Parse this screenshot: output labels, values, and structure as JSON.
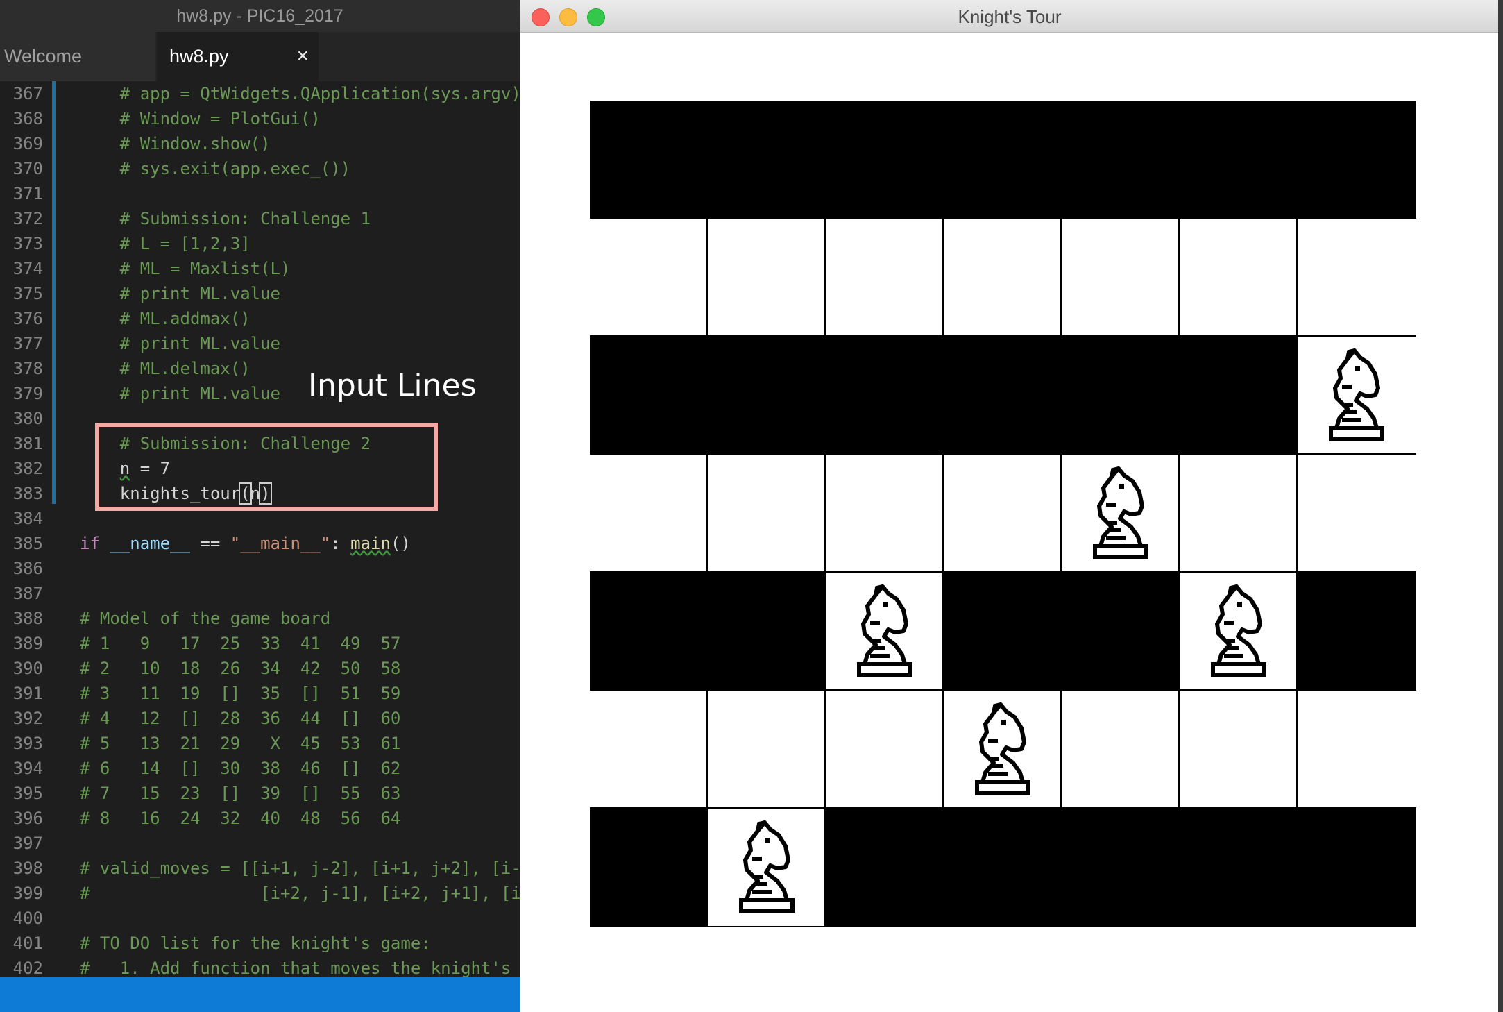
{
  "editor": {
    "window_title": "hw8.py - PIC16_2017",
    "tabs": [
      {
        "label": "Welcome"
      },
      {
        "label": "hw8.py",
        "close": "×"
      }
    ]
  },
  "code_lines": [
    {
      "n": "367",
      "t": "    # app = QtWidgets.QApplication(sys.argv)"
    },
    {
      "n": "368",
      "t": "    # Window = PlotGui()"
    },
    {
      "n": "369",
      "t": "    # Window.show()"
    },
    {
      "n": "370",
      "t": "    # sys.exit(app.exec_())"
    },
    {
      "n": "371",
      "t": ""
    },
    {
      "n": "372",
      "t": "    # Submission: Challenge 1"
    },
    {
      "n": "373",
      "t": "    # L = [1,2,3]"
    },
    {
      "n": "374",
      "t": "    # ML = Maxlist(L)"
    },
    {
      "n": "375",
      "t": "    # print ML.value"
    },
    {
      "n": "376",
      "t": "    # ML.addmax()"
    },
    {
      "n": "377",
      "t": "    # print ML.value"
    },
    {
      "n": "378",
      "t": "    # ML.delmax()"
    },
    {
      "n": "379",
      "t": "    # print ML.value"
    },
    {
      "n": "380",
      "t": ""
    },
    {
      "n": "381",
      "t": "    # Submission: Challenge 2"
    },
    {
      "n": "382",
      "t": "    n = 7"
    },
    {
      "n": "383",
      "t": "    knights_tour(n)"
    },
    {
      "n": "384",
      "t": ""
    },
    {
      "n": "385",
      "t": "if __name__ == \"__main__\": main()"
    },
    {
      "n": "386",
      "t": ""
    },
    {
      "n": "387",
      "t": ""
    },
    {
      "n": "388",
      "t": "# Model of the game board"
    },
    {
      "n": "389",
      "t": "# 1   9   17  25  33  41  49  57"
    },
    {
      "n": "390",
      "t": "# 2   10  18  26  34  42  50  58"
    },
    {
      "n": "391",
      "t": "# 3   11  19  []  35  []  51  59"
    },
    {
      "n": "392",
      "t": "# 4   12  []  28  36  44  []  60"
    },
    {
      "n": "393",
      "t": "# 5   13  21  29   X  45  53  61"
    },
    {
      "n": "394",
      "t": "# 6   14  []  30  38  46  []  62"
    },
    {
      "n": "395",
      "t": "# 7   15  23  []  39  []  55  63"
    },
    {
      "n": "396",
      "t": "# 8   16  24  32  40  48  56  64"
    },
    {
      "n": "397",
      "t": ""
    },
    {
      "n": "398",
      "t": "# valid_moves = [[i+1, j-2], [i+1, j+2], [i-"
    },
    {
      "n": "399",
      "t": "#                 [i+2, j-1], [i+2, j+1], [i"
    },
    {
      "n": "400",
      "t": ""
    },
    {
      "n": "401",
      "t": "# TO DO list for the knight's game:"
    },
    {
      "n": "402",
      "t": "#   1. Add function that moves the knight's"
    }
  ],
  "annotation": {
    "label": "Input Lines"
  },
  "knights_tour": {
    "window_title": "Knight's Tour",
    "board_size": 7,
    "board_colors": {
      "dark": "#000000",
      "light": "#ffffff"
    },
    "board_rows": [
      "BBBBBBB",
      "WWWWWWW",
      "BBBBBBW",
      "WWWWWWW",
      "BBWBBWB",
      "WWWWWWW",
      "BWBBBBB"
    ],
    "knights": [
      {
        "row": 2,
        "col": 6
      },
      {
        "row": 3,
        "col": 4
      },
      {
        "row": 4,
        "col": 2
      },
      {
        "row": 4,
        "col": 5
      },
      {
        "row": 5,
        "col": 3
      },
      {
        "row": 6,
        "col": 1
      }
    ],
    "knight_icon": "white-knight-chess-piece"
  }
}
